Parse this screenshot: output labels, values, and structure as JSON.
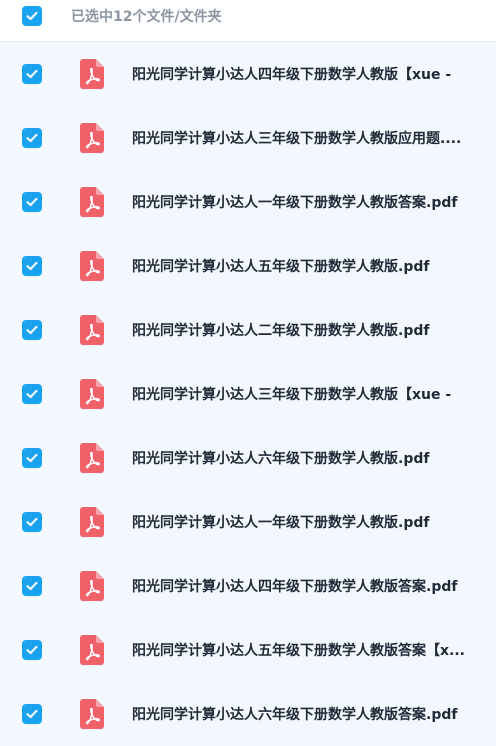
{
  "header": {
    "selection_text": "已选中12个文件/文件夹"
  },
  "files": [
    {
      "name": "阳光同学计算小达人四年级下册数学人教版【xue -",
      "icon": "pdf-icon",
      "checked": true
    },
    {
      "name": "阳光同学计算小达人三年级下册数学人教版应用题....",
      "icon": "pdf-icon",
      "checked": true
    },
    {
      "name": "阳光同学计算小达人一年级下册数学人教版答案.pdf",
      "icon": "pdf-icon",
      "checked": true
    },
    {
      "name": "阳光同学计算小达人五年级下册数学人教版.pdf",
      "icon": "pdf-icon",
      "checked": true
    },
    {
      "name": "阳光同学计算小达人二年级下册数学人教版.pdf",
      "icon": "pdf-icon",
      "checked": true
    },
    {
      "name": "阳光同学计算小达人三年级下册数学人教版【xue -",
      "icon": "pdf-icon",
      "checked": true
    },
    {
      "name": "阳光同学计算小达人六年级下册数学人教版.pdf",
      "icon": "pdf-icon",
      "checked": true
    },
    {
      "name": "阳光同学计算小达人一年级下册数学人教版.pdf",
      "icon": "pdf-icon",
      "checked": true
    },
    {
      "name": "阳光同学计算小达人四年级下册数学人教版答案.pdf",
      "icon": "pdf-icon",
      "checked": true
    },
    {
      "name": "阳光同学计算小达人五年级下册数学人教版答案【x...",
      "icon": "pdf-icon",
      "checked": true
    },
    {
      "name": "阳光同学计算小达人六年级下册数学人教版答案.pdf",
      "icon": "pdf-icon",
      "checked": true
    }
  ],
  "colors": {
    "checkbox": "#1aa3f0",
    "pdf_icon": "#f0616a",
    "background": "#f2f8fd"
  }
}
